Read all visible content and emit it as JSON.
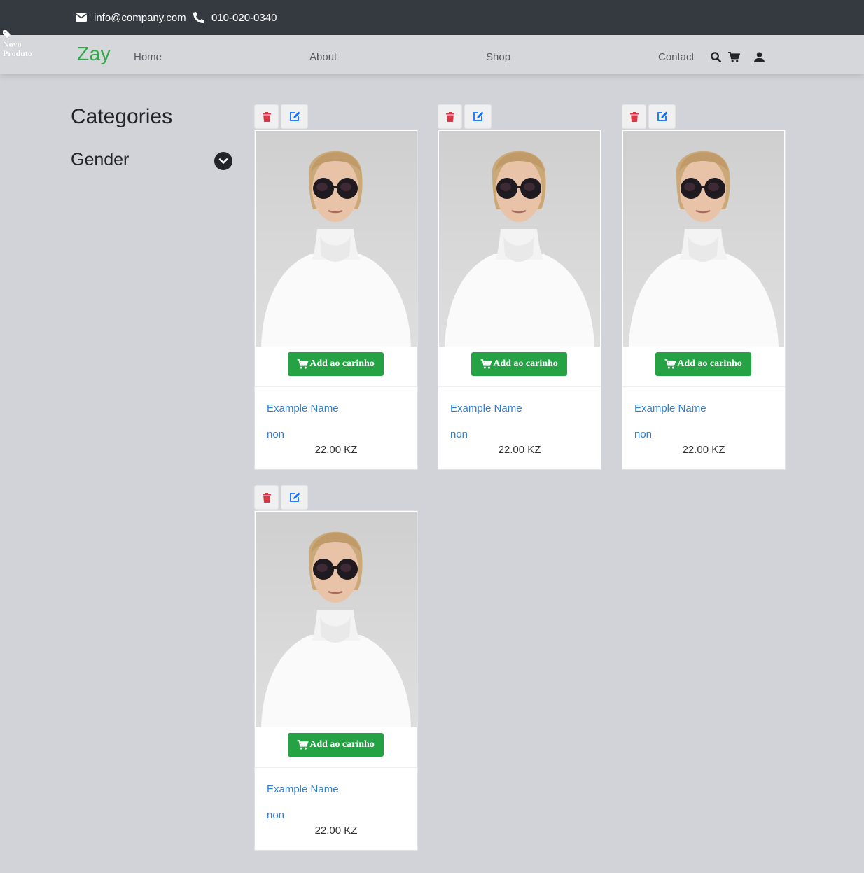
{
  "topbar": {
    "email": "info@company.com",
    "phone": "010-020-0340"
  },
  "novo": {
    "line1": "Novo",
    "line2": "Produto"
  },
  "nav": {
    "brand": "Zay",
    "links": [
      "Home",
      "About",
      "Shop",
      "Contact"
    ],
    "icons": [
      "search-icon",
      "cart-icon",
      "user-icon"
    ]
  },
  "sidebar": {
    "title": "Categories",
    "gender": "Gender"
  },
  "colors": {
    "brand": "#2ea84a",
    "cart_button": "#25a244",
    "link": "#2f7fd3",
    "delete": "#dc3545",
    "edit": "#0d6efd"
  },
  "products": [
    {
      "name": "Example Name",
      "tag": "non",
      "price": "22.00 KZ",
      "button": "Add ao carinho"
    },
    {
      "name": "Example Name",
      "tag": "non",
      "price": "22.00 KZ",
      "button": "Add ao carinho"
    },
    {
      "name": "Example Name",
      "tag": "non",
      "price": "22.00 KZ",
      "button": "Add ao carinho"
    },
    {
      "name": "Example Name",
      "tag": "non",
      "price": "22.00 KZ",
      "button": "Add ao carinho"
    }
  ]
}
